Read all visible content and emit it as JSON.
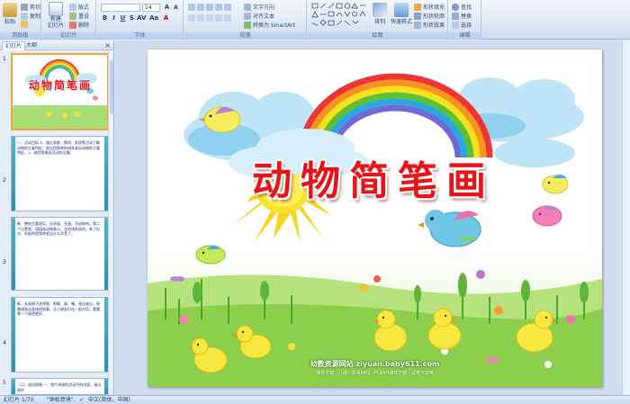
{
  "ribbon": {
    "groups": [
      {
        "label": "剪贴板"
      },
      {
        "label": "幻灯片"
      },
      {
        "label": "字体"
      },
      {
        "label": "段落"
      },
      {
        "label": "绘图"
      },
      {
        "label": "编辑"
      }
    ],
    "clipboard": {
      "paste": "粘贴",
      "cut": "剪切",
      "copy": "复制",
      "format_painter": "格式刷"
    },
    "slides": {
      "new_slide": "新建",
      "new_slide_2": "幻灯片",
      "layout": "版式",
      "reset": "重设",
      "delete": "删除"
    },
    "font": {
      "size": "14"
    },
    "paragraph": {
      "text_direction": "文字方向",
      "align_text": "对齐文本",
      "convert_smartart": "转换为 SmartArt"
    },
    "drawing": {
      "arrange": "排列",
      "quick_styles": "快速样式",
      "shape_fill": "形状填充",
      "shape_outline": "形状轮廓",
      "shape_effects": "形状效果"
    },
    "editing": {
      "find": "查找",
      "replace": "替换",
      "select": "选择"
    }
  },
  "left_pane": {
    "tabs": [
      "幻灯片",
      "大纲"
    ],
    "close": "×",
    "thumbnails": [
      {
        "num": "1",
        "title": "动物简笔画"
      },
      {
        "num": "2",
        "text": "一、活动目标 1、通过观察、猜测、发现等活动了解动物的主要特征，尝试用简单的线条画出动物的主要特征。2、体验简笔画活动的乐趣。"
      },
      {
        "num": "3",
        "text": "新：教给主题说话，先说画、先画，活动结构，第二个位置和，语段画动物表示，及的线条组合，有了形式，你画的是简单发出什么声音了。"
      },
      {
        "num": "4",
        "text": "新，先画猴子选择图、眼睛、鼻、嘴，画出来后，接着描画出身体的轮廓，让小朋友们在一起对比，看看哪一个画得更好。"
      },
      {
        "num": "5",
        "text": "（二）说出图像 一、图片来源的活动中的内容，请出画作"
      }
    ]
  },
  "slide": {
    "title": "动物简笔画",
    "footer_site": "幼教资源网站 ziyuan.baby611.com",
    "footer_links": "课件下载 · 儿歌 · 故事MP3 · FLASH课件下载 · 试卷下载等"
  },
  "status": {
    "slide_info": "幻灯片 1/70",
    "theme": "\"钟松意境\"",
    "language": "中文(简体，中国)"
  },
  "colors": {
    "title_red": "#e8141a",
    "ribbon_bg": "#dbe6f4",
    "selected_border": "#f5a03c",
    "grass": "#7cc243",
    "sky": "#7ecbea"
  }
}
